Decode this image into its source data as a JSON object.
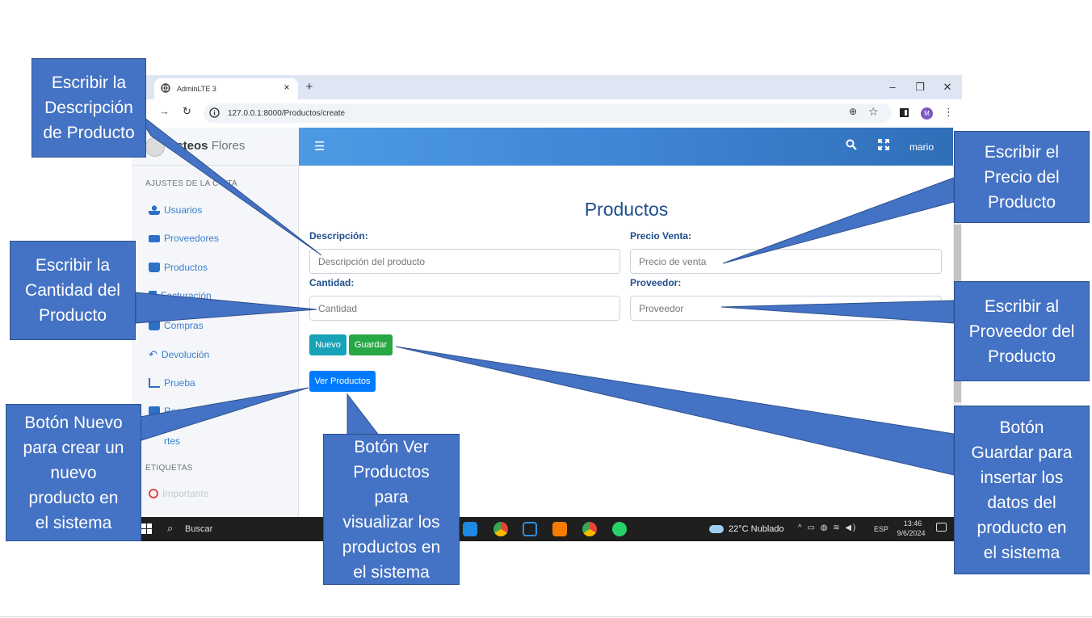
{
  "browser": {
    "tab_title": "AdminLTE 3",
    "tab_close": "×",
    "new_tab": "+",
    "url": "127.0.0.1:8000/Productos/create",
    "window_controls": {
      "minimize": "–",
      "restore": "❐",
      "close": "✕"
    },
    "profile_initial": "M"
  },
  "sidebar": {
    "brand_bold": "acteos",
    "brand_light": " Flores",
    "section_account": "AJUSTES DE LA C    NTA",
    "items": [
      {
        "label": "Usuarios",
        "icon": "user-icon"
      },
      {
        "label": "Proveedores",
        "icon": "truck-icon"
      },
      {
        "label": "Productos",
        "icon": "bag-icon"
      },
      {
        "label": "Facturación",
        "icon": "invoice-icon"
      },
      {
        "label": "Compras",
        "icon": "bag-icon"
      },
      {
        "label": "Devolución",
        "icon": "undo-icon"
      },
      {
        "label": "Prueba",
        "icon": "chart-icon"
      },
      {
        "label": "Respaldo",
        "icon": "lock-icon"
      },
      {
        "label": "rtes",
        "icon": "report-icon"
      }
    ],
    "section_tags": "ETIQUETAS",
    "tag_item": "Importante"
  },
  "navbar": {
    "user": "mario"
  },
  "form": {
    "title": "Productos",
    "descripcion": {
      "label": "Descripción:",
      "placeholder": "Descripción del producto"
    },
    "precio": {
      "label": "Precio Venta:",
      "placeholder": "Precio de venta"
    },
    "cantidad": {
      "label": "Cantidad:",
      "placeholder": "Cantidad"
    },
    "proveedor": {
      "label": "Proveedor:",
      "placeholder": "Proveedor"
    },
    "btn_nuevo": "Nuevo",
    "btn_guardar": "Guardar",
    "btn_ver": "Ver Productos"
  },
  "taskbar": {
    "search_label": "Buscar",
    "weather": "22°C  Nublado",
    "lang": "ESP",
    "time": "13:46",
    "date": "9/6/2024"
  },
  "callouts": {
    "descripcion": "Escribir la\nDescripción\nde Producto",
    "cantidad": "Escribir la\nCantidad del\nProducto",
    "nuevo": "Botón Nuevo\npara crear un\nnuevo\nproducto en\nel sistema",
    "ver": "Botón Ver\nProductos\npara\nvisualizar los\nproductos en\nel sistema",
    "precio": "Escribir el\nPrecio del\nProducto",
    "proveedor": "Escribir al\nProveedor del\nProducto",
    "guardar": "Botón\nGuardar para\ninsertar los\ndatos del\nproducto en\nel sistema"
  },
  "colors": {
    "callout": "#4472c4",
    "navbar_start": "#4d9ae3",
    "navbar_end": "#2f6fb8",
    "btn_nuevo": "#17a2b8",
    "btn_guardar": "#28a745",
    "btn_ver": "#007bff"
  }
}
